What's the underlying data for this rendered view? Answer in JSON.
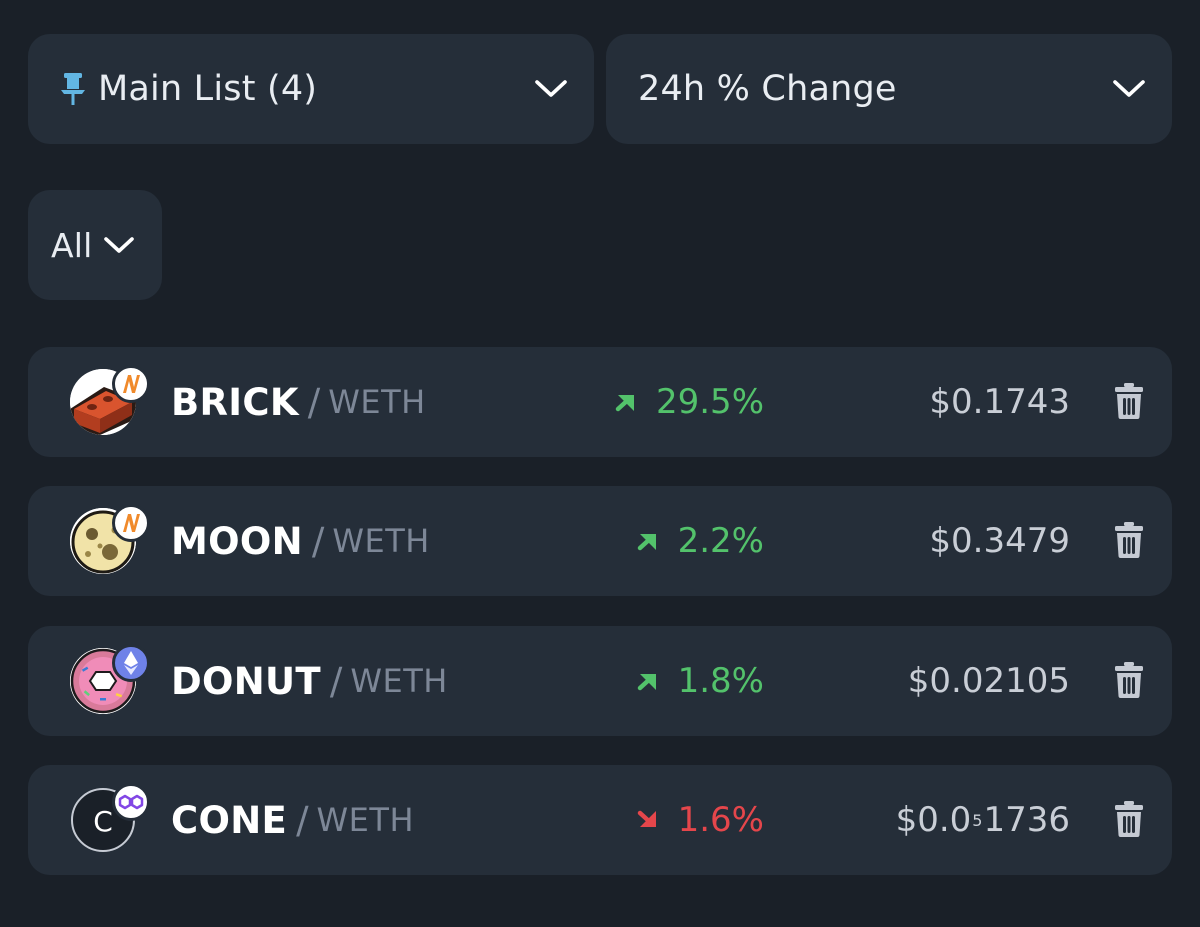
{
  "list_dropdown": {
    "label": "Main List (4)"
  },
  "sort_dropdown": {
    "label": "24h % Change"
  },
  "filter_dropdown": {
    "label": "All"
  },
  "colors": {
    "up": "#53c26b",
    "down": "#e5464b",
    "background": "#1a2028",
    "card": "#252e39"
  },
  "rows": [
    {
      "base": "BRICK",
      "separator": "/",
      "quote": "WETH",
      "change": "29.5%",
      "direction": "up",
      "price": "$0.1743",
      "price_main": "$0.1743",
      "price_sub": "",
      "price_tail": "",
      "chain_icon": "nitro-icon",
      "token_icon": "brick-icon"
    },
    {
      "base": "MOON",
      "separator": "/",
      "quote": "WETH",
      "change": "2.2%",
      "direction": "up",
      "price": "$0.3479",
      "price_main": "$0.3479",
      "price_sub": "",
      "price_tail": "",
      "chain_icon": "nitro-icon",
      "token_icon": "moon-icon"
    },
    {
      "base": "DONUT",
      "separator": "/",
      "quote": "WETH",
      "change": "1.8%",
      "direction": "up",
      "price": "$0.02105",
      "price_main": "$0.02105",
      "price_sub": "",
      "price_tail": "",
      "chain_icon": "ethereum-icon",
      "token_icon": "donut-icon"
    },
    {
      "base": "CONE",
      "separator": "/",
      "quote": "WETH",
      "change": "1.6%",
      "direction": "down",
      "price": "$0.0₅1736",
      "price_main": "$0.0",
      "price_sub": "5",
      "price_tail": "1736",
      "chain_icon": "polygon-icon",
      "token_icon": "cone-icon"
    }
  ]
}
